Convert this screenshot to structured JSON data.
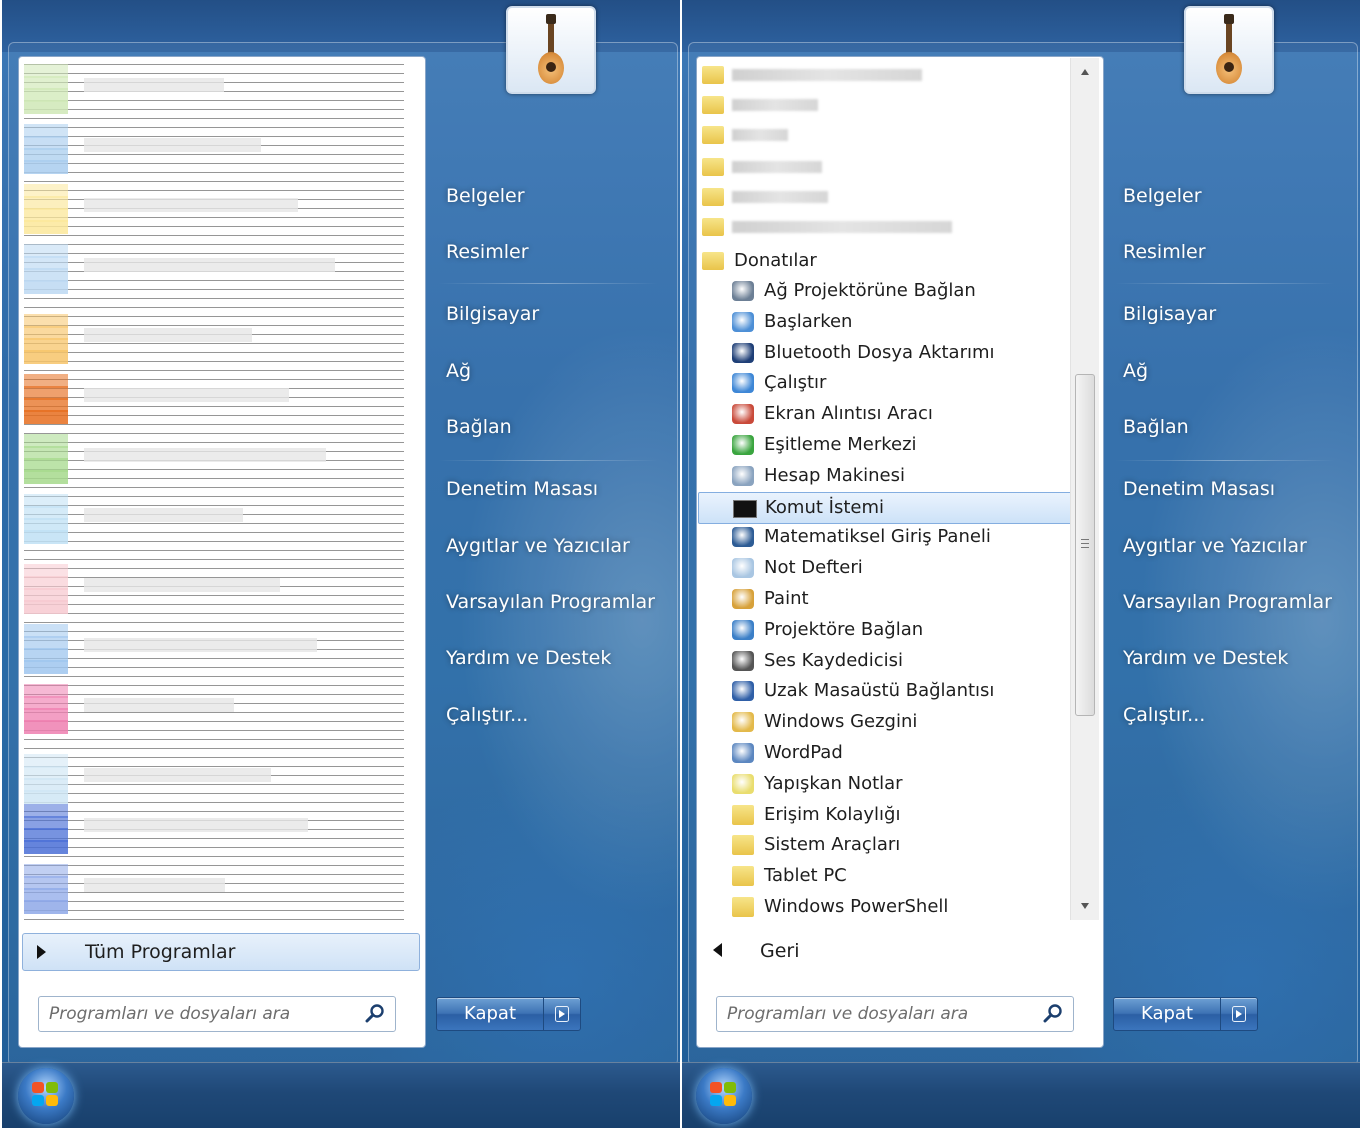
{
  "left_panel": {
    "all_programs_label": "Tüm Programlar",
    "search_placeholder": "Programları ve dosyaları ara",
    "shutdown_label": "Kapat"
  },
  "right_panel": {
    "back_label": "Geri",
    "search_placeholder": "Programları ve dosyaları ara",
    "shutdown_label": "Kapat"
  },
  "right_links": [
    {
      "label": "Belgeler"
    },
    {
      "label": "Resimler"
    },
    {
      "label": "Bilgisayar"
    },
    {
      "label": "Ağ"
    },
    {
      "label": "Bağlan"
    },
    {
      "label": "Denetim Masası"
    },
    {
      "label": "Aygıtlar ve Yazıcılar"
    },
    {
      "label": "Varsayılan Programlar"
    },
    {
      "label": "Yardım ve Destek"
    },
    {
      "label": "Çalıştır..."
    }
  ],
  "programs": {
    "folder_label": "Donatılar",
    "items": [
      {
        "label": "Ağ Projektörüne Bağlan",
        "icon": "network-projector-icon"
      },
      {
        "label": "Başlarken",
        "icon": "getting-started-icon"
      },
      {
        "label": "Bluetooth Dosya Aktarımı",
        "icon": "bluetooth-icon"
      },
      {
        "label": "Çalıştır",
        "icon": "run-icon"
      },
      {
        "label": "Ekran Alıntısı Aracı",
        "icon": "snipping-tool-icon"
      },
      {
        "label": "Eşitleme Merkezi",
        "icon": "sync-center-icon"
      },
      {
        "label": "Hesap Makinesi",
        "icon": "calculator-icon"
      },
      {
        "label": "Komut İstemi",
        "icon": "command-prompt-icon",
        "selected": true
      },
      {
        "label": "Matematiksel Giriş Paneli",
        "icon": "math-input-icon"
      },
      {
        "label": "Not Defteri",
        "icon": "notepad-icon"
      },
      {
        "label": "Paint",
        "icon": "paint-icon"
      },
      {
        "label": "Projektöre Bağlan",
        "icon": "projector-icon"
      },
      {
        "label": "Ses Kaydedicisi",
        "icon": "microphone-icon"
      },
      {
        "label": "Uzak Masaüstü Bağlantısı",
        "icon": "remote-desktop-icon"
      },
      {
        "label": "Windows Gezgini",
        "icon": "explorer-icon"
      },
      {
        "label": "WordPad",
        "icon": "wordpad-icon"
      },
      {
        "label": "Yapışkan Notlar",
        "icon": "sticky-notes-icon"
      },
      {
        "label": "Erişim Kolaylığı",
        "icon": "folder-icon"
      },
      {
        "label": "Sistem Araçları",
        "icon": "folder-icon"
      },
      {
        "label": "Tablet PC",
        "icon": "folder-icon"
      },
      {
        "label": "Windows PowerShell",
        "icon": "folder-icon"
      }
    ]
  },
  "colors": {
    "accent_blue": "#2d6aa8",
    "selection": "#cde2f8",
    "folder": "#e9c44a"
  }
}
